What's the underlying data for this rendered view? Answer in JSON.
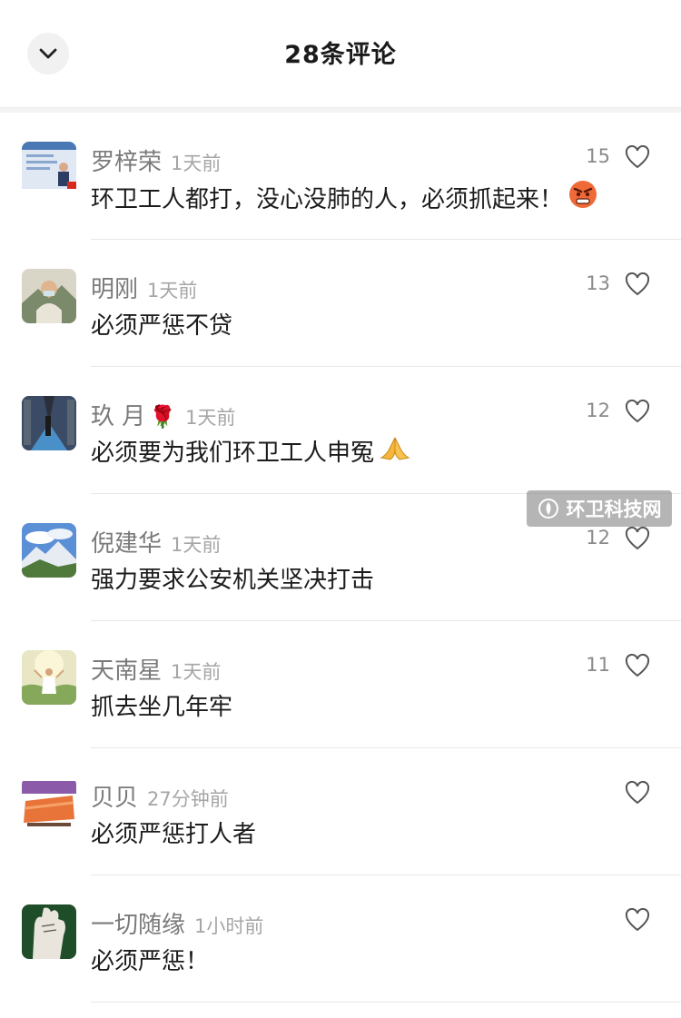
{
  "header": {
    "title": "28条评论",
    "back_icon": "chevron-down-icon"
  },
  "comments": [
    {
      "username": "罗梓荣",
      "badge": "",
      "time": "1天前",
      "text": "环卫工人都打，没心没肺的人，必须抓起来！",
      "emoji": "angry-face",
      "likes": "15"
    },
    {
      "username": "明刚",
      "badge": "",
      "time": "1天前",
      "text": "必须严惩不贷",
      "emoji": "",
      "likes": "13"
    },
    {
      "username": "玖 月",
      "badge": "🌹",
      "time": "1天前",
      "text": "必须要为我们环卫工人申冤",
      "emoji": "folded-hands",
      "likes": "12"
    },
    {
      "username": "倪建华",
      "badge": "",
      "time": "1天前",
      "text": "强力要求公安机关坚决打击",
      "emoji": "",
      "likes": "12"
    },
    {
      "username": "天南星",
      "badge": "",
      "time": "1天前",
      "text": "抓去坐几年牢",
      "emoji": "",
      "likes": "11"
    },
    {
      "username": "贝贝",
      "badge": "",
      "time": "27分钟前",
      "text": "必须严惩打人者",
      "emoji": "",
      "likes": ""
    },
    {
      "username": "一切随缘",
      "badge": "",
      "time": "1小时前",
      "text": "必须严惩！",
      "emoji": "",
      "likes": ""
    }
  ],
  "watermark": {
    "text": "环卫科技网"
  },
  "colors": {
    "username": "#7a7a7a",
    "time": "#a6a6a6",
    "text": "#1c1c1c",
    "divider": "#e9e9e9"
  }
}
